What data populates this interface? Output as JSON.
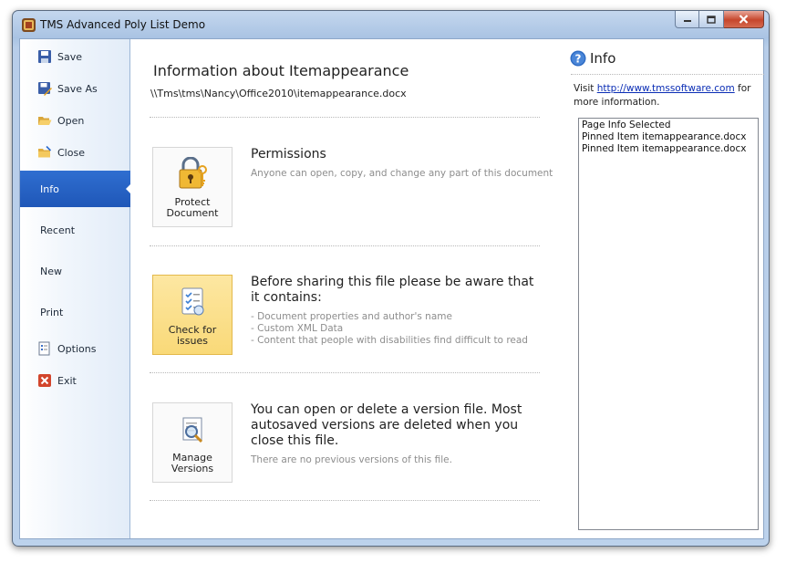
{
  "window": {
    "title": "TMS Advanced Poly List Demo"
  },
  "sidebar": {
    "items": [
      {
        "label": "Save",
        "icon": "save-icon"
      },
      {
        "label": "Save As",
        "icon": "save-as-icon"
      },
      {
        "label": "Open",
        "icon": "open-folder-icon"
      },
      {
        "label": "Close",
        "icon": "close-folder-icon"
      },
      {
        "label": "Info",
        "active": true
      },
      {
        "label": "Recent"
      },
      {
        "label": "New"
      },
      {
        "label": "Print"
      },
      {
        "label": "Options",
        "icon": "options-icon"
      },
      {
        "label": "Exit",
        "icon": "exit-icon"
      }
    ]
  },
  "main": {
    "title": "Information about Itemappearance",
    "path": "\\\\Tms\\tms\\Nancy\\Office2010\\itemappearance.docx",
    "sections": [
      {
        "button_label": "Protect Document",
        "icon": "lock-keys-icon",
        "heading": "Permissions",
        "description": [
          "Anyone can open, copy, and change any part of this document"
        ]
      },
      {
        "button_label": "Check for issues",
        "icon": "checklist-icon",
        "heading": "Before sharing this file please be aware that it contains:",
        "description": [
          "- Document properties and author's name",
          "- Custom XML Data",
          "- Content that people with disabilities find difficult to read"
        ]
      },
      {
        "button_label": "Manage Versions",
        "icon": "magnifier-document-icon",
        "heading": "You can open or delete a version file. Most autosaved versions are deleted when you close this file.",
        "description": [
          "There are no previous versions of this file."
        ]
      }
    ]
  },
  "right_pane": {
    "title": "Info",
    "visit_prefix": "Visit ",
    "link": "http://www.tmssoftware.com",
    "visit_suffix": " for more information.",
    "log": [
      "Page Info Selected",
      "Pinned Item itemappearance.docx",
      "Pinned Item itemappearance.docx"
    ]
  },
  "colors": {
    "accent": "#2563c4",
    "hot_button": "#fbe08e",
    "link": "#0a2db5"
  }
}
